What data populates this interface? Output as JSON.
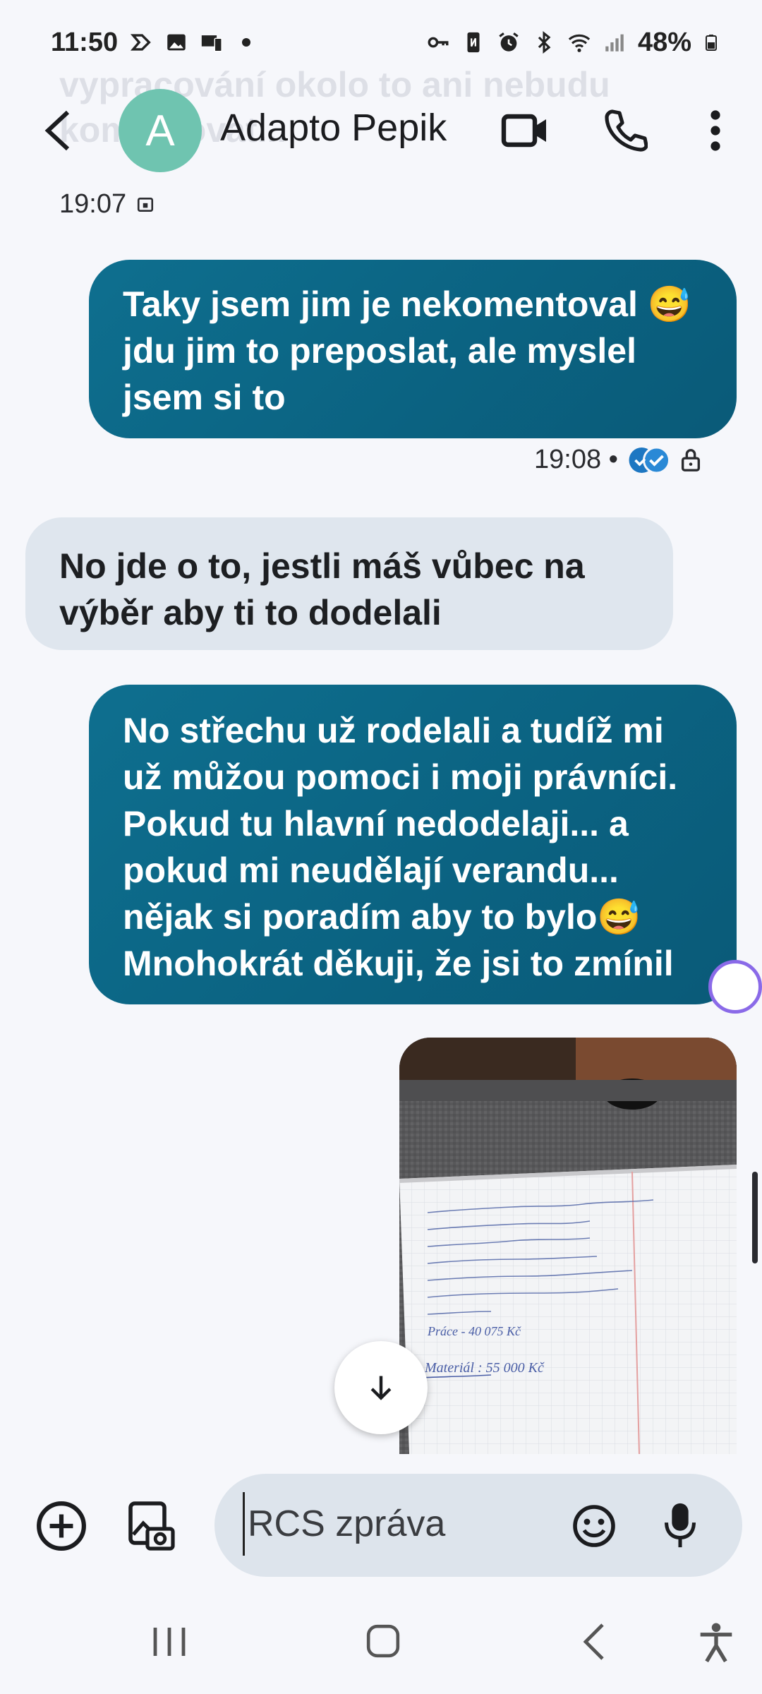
{
  "status_bar": {
    "time": "11:50",
    "battery": "48%"
  },
  "ghost_text": "vypracování okolo to ani nebudu komentovat...",
  "header": {
    "avatar_letter": "A",
    "contact_name": "Adapto Pepik"
  },
  "messages": [
    {
      "type": "timestamp",
      "time": "19:07"
    },
    {
      "type": "outgoing",
      "text": "Taky jsem jim je nekomentoval 😅 jdu jim to preposlat, ale myslel jsem si to",
      "time": "19:08 •"
    },
    {
      "type": "incoming",
      "text": "No jde o to, jestli máš vůbec na výběr aby ti to dodelali"
    },
    {
      "type": "outgoing",
      "text": "No střechu už rodelali a tudíž mi už můžou pomoci i moji právníci. Pokud tu hlavní nedodelaji... a pokud mi neudělají verandu... nějak si poradím aby to bylo😅 Mnohokrát děkuji, že jsi to zmínil"
    }
  ],
  "image_note": {
    "total": "Práce - 40 075 Kč",
    "material": "Materiál : 55 000 Kč"
  },
  "compose": {
    "placeholder": "RCS zpráva"
  },
  "colors": {
    "outgoing_bubble": "#0b6382",
    "incoming_bubble": "#dfe6ee",
    "avatar": "#6fc4b0",
    "background": "#f6f7fb"
  }
}
